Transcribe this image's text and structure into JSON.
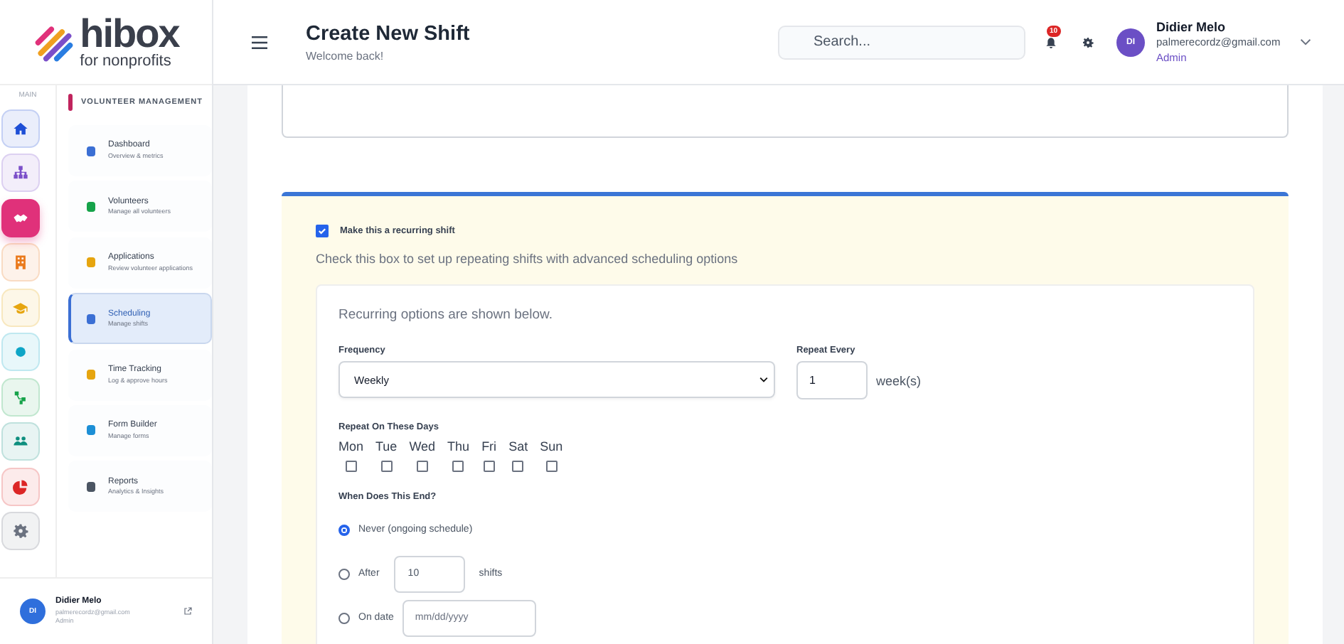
{
  "logo": {
    "name": "hibox",
    "tagline": "for nonprofits"
  },
  "rail": {
    "label": "MAIN",
    "items": [
      {
        "color": "#1e4fd6",
        "selected": false
      },
      {
        "color": "#7b4fc9",
        "selected": false
      },
      {
        "color": "#e0317a",
        "selected": true
      },
      {
        "color": "#ea7a1c",
        "selected": false
      },
      {
        "color": "#e6a50f",
        "selected": false
      },
      {
        "color": "#0ea5c6",
        "selected": false
      },
      {
        "color": "#16a34a",
        "selected": false
      },
      {
        "color": "#0f8f7f",
        "selected": false
      },
      {
        "color": "#dc2626",
        "selected": false
      },
      {
        "color": "#6b7280",
        "selected": false
      }
    ]
  },
  "nav": {
    "section": "VOLUNTEER MANAGEMENT",
    "items": [
      {
        "title": "Dashboard",
        "subtitle": "Overview & metrics",
        "color": "#3b6fd4",
        "selected": false
      },
      {
        "title": "Volunteers",
        "subtitle": "Manage all volunteers",
        "color": "#16a34a",
        "selected": false
      },
      {
        "title": "Applications",
        "subtitle": "Review volunteer applications",
        "color": "#e6a50f",
        "selected": false
      },
      {
        "title": "Scheduling",
        "subtitle": "Manage shifts",
        "color": "#3b6fd4",
        "selected": true
      },
      {
        "title": "Time Tracking",
        "subtitle": "Log & approve hours",
        "color": "#e6a50f",
        "selected": false
      },
      {
        "title": "Form Builder",
        "subtitle": "Manage forms",
        "color": "#1d8fd6",
        "selected": false
      },
      {
        "title": "Reports",
        "subtitle": "Analytics & Insights",
        "color": "#4b5563",
        "selected": false
      }
    ]
  },
  "sidebar_user": {
    "initials": "DI",
    "name": "Didier Melo",
    "email": "palmerecordz@gmail.com",
    "role": "Admin"
  },
  "header": {
    "title": "Create New Shift",
    "subtitle": "Welcome back!",
    "search": {
      "placeholder": "Search..."
    },
    "notification_count": "10",
    "user": {
      "initials": "DI",
      "name": "Didier Melo",
      "email": "palmerecordz@gmail.com",
      "role": "Admin"
    }
  },
  "recurring": {
    "checkbox_label": "Make this a recurring shift",
    "checked": true,
    "help": "Check this box to set up repeating shifts with advanced scheduling options",
    "note": "Recurring options are shown below.",
    "frequency": {
      "label": "Frequency",
      "value": "Weekly"
    },
    "repeat_every": {
      "label": "Repeat Every",
      "value": "1",
      "unit": "week(s)"
    },
    "days": {
      "label": "Repeat On These Days",
      "items": [
        {
          "label": "Mon",
          "checked": false
        },
        {
          "label": "Tue",
          "checked": false
        },
        {
          "label": "Wed",
          "checked": false
        },
        {
          "label": "Thu",
          "checked": false
        },
        {
          "label": "Fri",
          "checked": false
        },
        {
          "label": "Sat",
          "checked": false
        },
        {
          "label": "Sun",
          "checked": false
        }
      ]
    },
    "end": {
      "label": "When Does This End?",
      "options": [
        {
          "kind": "plain",
          "label": "Never (ongoing schedule)",
          "selected": true
        },
        {
          "kind": "count",
          "label": "After",
          "value": "10",
          "suffix": "shifts",
          "selected": false
        },
        {
          "kind": "date",
          "label": "On date",
          "placeholder": "mm/dd/yyyy",
          "selected": false
        }
      ]
    }
  }
}
